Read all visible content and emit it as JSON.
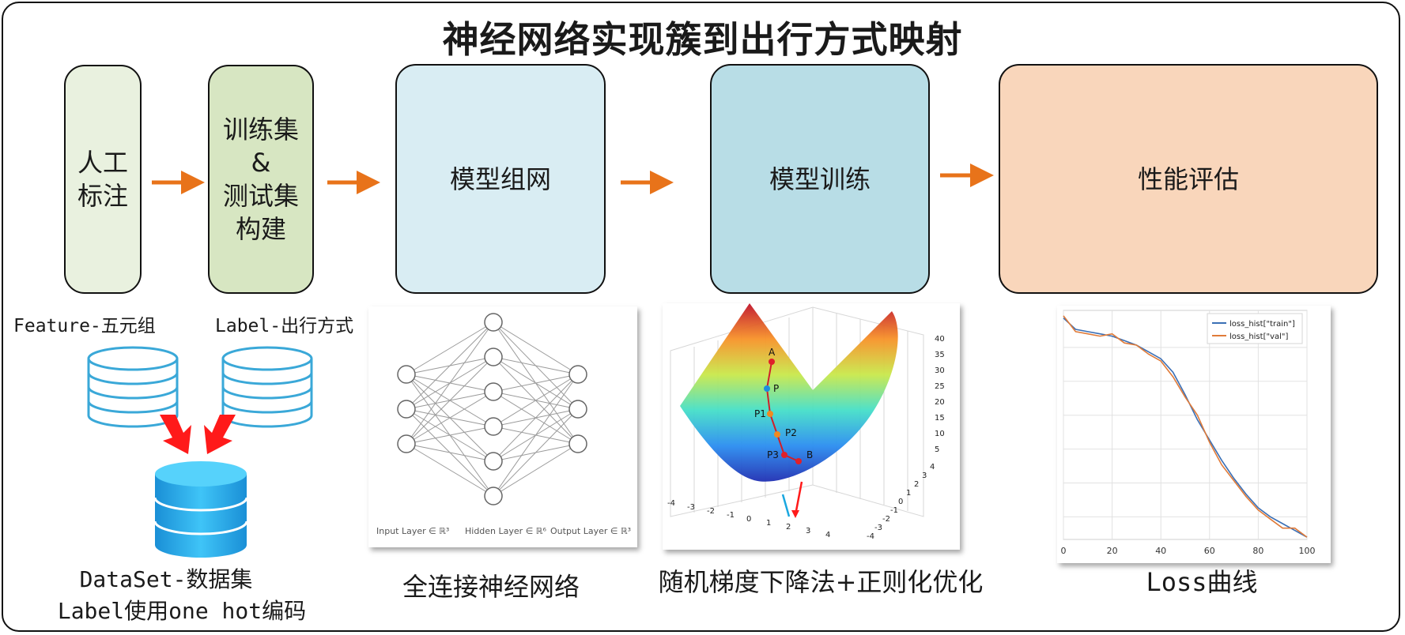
{
  "title": "神经网络实现簇到出行方式映射",
  "colors": {
    "arrow": "#e8731a",
    "box1": "#e9f1df",
    "box2": "#d7e6c2",
    "box3": "#d9edf3",
    "box4": "#b8dde6",
    "box5": "#f9d6bb",
    "db_outline": "#3aa8d8",
    "db_fill": "#2aa7e6",
    "red_arrow": "#ff1a1a"
  },
  "pipeline": [
    {
      "label": "人工\n标注"
    },
    {
      "label": "训练集\n&\n测试集\n构建"
    },
    {
      "label": "模型组网"
    },
    {
      "label": "模型训练"
    },
    {
      "label": "性能评估"
    }
  ],
  "data_section": {
    "feature_label": "Feature-五元组",
    "label_label": "Label-出行方式",
    "dataset_caption_line1": "DataSet-数据集",
    "dataset_caption_line2": "Label使用one hot编码"
  },
  "network_panel": {
    "caption": "全连接神经网络",
    "layer_sizes": [
      3,
      6,
      3
    ],
    "input_label": "Input Layer ∈ ℝ³",
    "hidden_label": "Hidden Layer ∈ ℝ⁶",
    "output_label": "Output Layer ∈ ℝ³"
  },
  "surface_panel": {
    "caption": "随机梯度下降法+正则化优化",
    "z_ticks": [
      "40",
      "35",
      "30",
      "25",
      "20",
      "15",
      "10",
      "5"
    ],
    "x_ticks": [
      "-4",
      "-3",
      "-2",
      "-1",
      "0",
      "1",
      "2",
      "3",
      "4"
    ],
    "y_ticks": [
      "4",
      "3",
      "2",
      "1",
      "0",
      "-1",
      "-2",
      "-3",
      "-4"
    ],
    "points": [
      "A",
      "P",
      "P1",
      "P2",
      "P3",
      "B"
    ]
  },
  "chart_data": {
    "type": "line",
    "caption": "Loss曲线",
    "xlim": [
      0,
      100
    ],
    "x_ticks": [
      0,
      20,
      40,
      60,
      80,
      100
    ],
    "grid": true,
    "legend_position": "top-right",
    "series": [
      {
        "name": "loss_hist[\"train\"]",
        "color": "#3a6fb5",
        "x": [
          0,
          5,
          10,
          15,
          20,
          25,
          30,
          35,
          40,
          45,
          50,
          55,
          60,
          65,
          70,
          75,
          80,
          85,
          90,
          95,
          100
        ],
        "values": [
          0.98,
          0.93,
          0.92,
          0.91,
          0.9,
          0.88,
          0.86,
          0.83,
          0.8,
          0.74,
          0.64,
          0.53,
          0.44,
          0.35,
          0.27,
          0.2,
          0.14,
          0.1,
          0.07,
          0.04,
          0.01
        ]
      },
      {
        "name": "loss_hist[\"val\"]",
        "color": "#e07b39",
        "x": [
          0,
          5,
          10,
          15,
          20,
          25,
          30,
          35,
          40,
          45,
          50,
          55,
          60,
          65,
          70,
          75,
          80,
          85,
          90,
          95,
          100
        ],
        "values": [
          0.99,
          0.92,
          0.91,
          0.9,
          0.91,
          0.87,
          0.86,
          0.82,
          0.79,
          0.72,
          0.63,
          0.55,
          0.43,
          0.33,
          0.26,
          0.19,
          0.13,
          0.09,
          0.05,
          0.05,
          0.01
        ]
      }
    ]
  }
}
